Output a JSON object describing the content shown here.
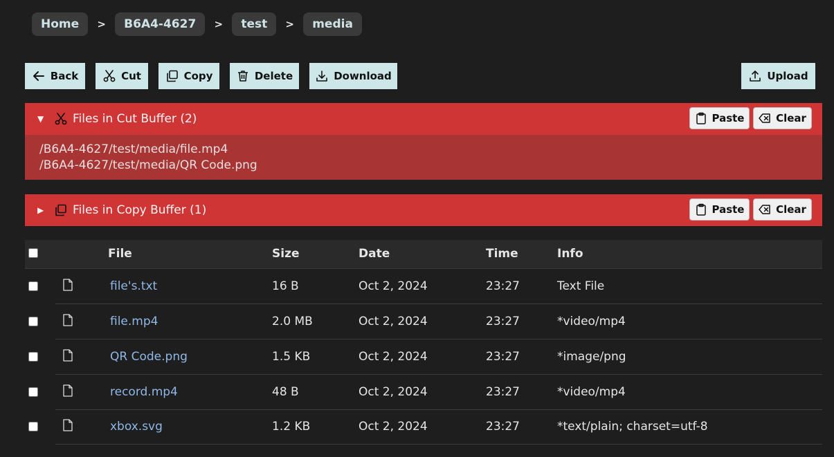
{
  "breadcrumb": {
    "items": [
      "Home",
      "B6A4-4627",
      "test",
      "media"
    ],
    "separator": ">"
  },
  "toolbar": {
    "back_label": "Back",
    "cut_label": "Cut",
    "copy_label": "Copy",
    "delete_label": "Delete",
    "download_label": "Download",
    "upload_label": "Upload"
  },
  "cut_buffer": {
    "title": "Files in Cut Buffer (2)",
    "expanded": true,
    "paste_label": "Paste",
    "clear_label": "Clear",
    "files": [
      "/B6A4-4627/test/media/file.mp4",
      "/B6A4-4627/test/media/QR Code.png"
    ]
  },
  "copy_buffer": {
    "title": "Files in Copy Buffer (1)",
    "expanded": false,
    "paste_label": "Paste",
    "clear_label": "Clear"
  },
  "table": {
    "headers": {
      "file": "File",
      "size": "Size",
      "date": "Date",
      "time": "Time",
      "info": "Info"
    },
    "rows": [
      {
        "name": "file's.txt",
        "size": "16 B",
        "date": "Oct 2, 2024",
        "time": "23:27",
        "info": "Text File"
      },
      {
        "name": "file.mp4",
        "size": "2.0 MB",
        "date": "Oct 2, 2024",
        "time": "23:27",
        "info": "*video/mp4"
      },
      {
        "name": "QR Code.png",
        "size": "1.5 KB",
        "date": "Oct 2, 2024",
        "time": "23:27",
        "info": "*image/png"
      },
      {
        "name": "record.mp4",
        "size": "48 B",
        "date": "Oct 2, 2024",
        "time": "23:27",
        "info": "*video/mp4"
      },
      {
        "name": "xbox.svg",
        "size": "1.2 KB",
        "date": "Oct 2, 2024",
        "time": "23:27",
        "info": "*text/plain; charset=utf-8"
      }
    ]
  },
  "colors": {
    "background": "#1e1e1e",
    "button": "#cde7e8",
    "buffer_header": "#d03536",
    "buffer_body": "#a93434",
    "link": "#8fb8e6"
  }
}
